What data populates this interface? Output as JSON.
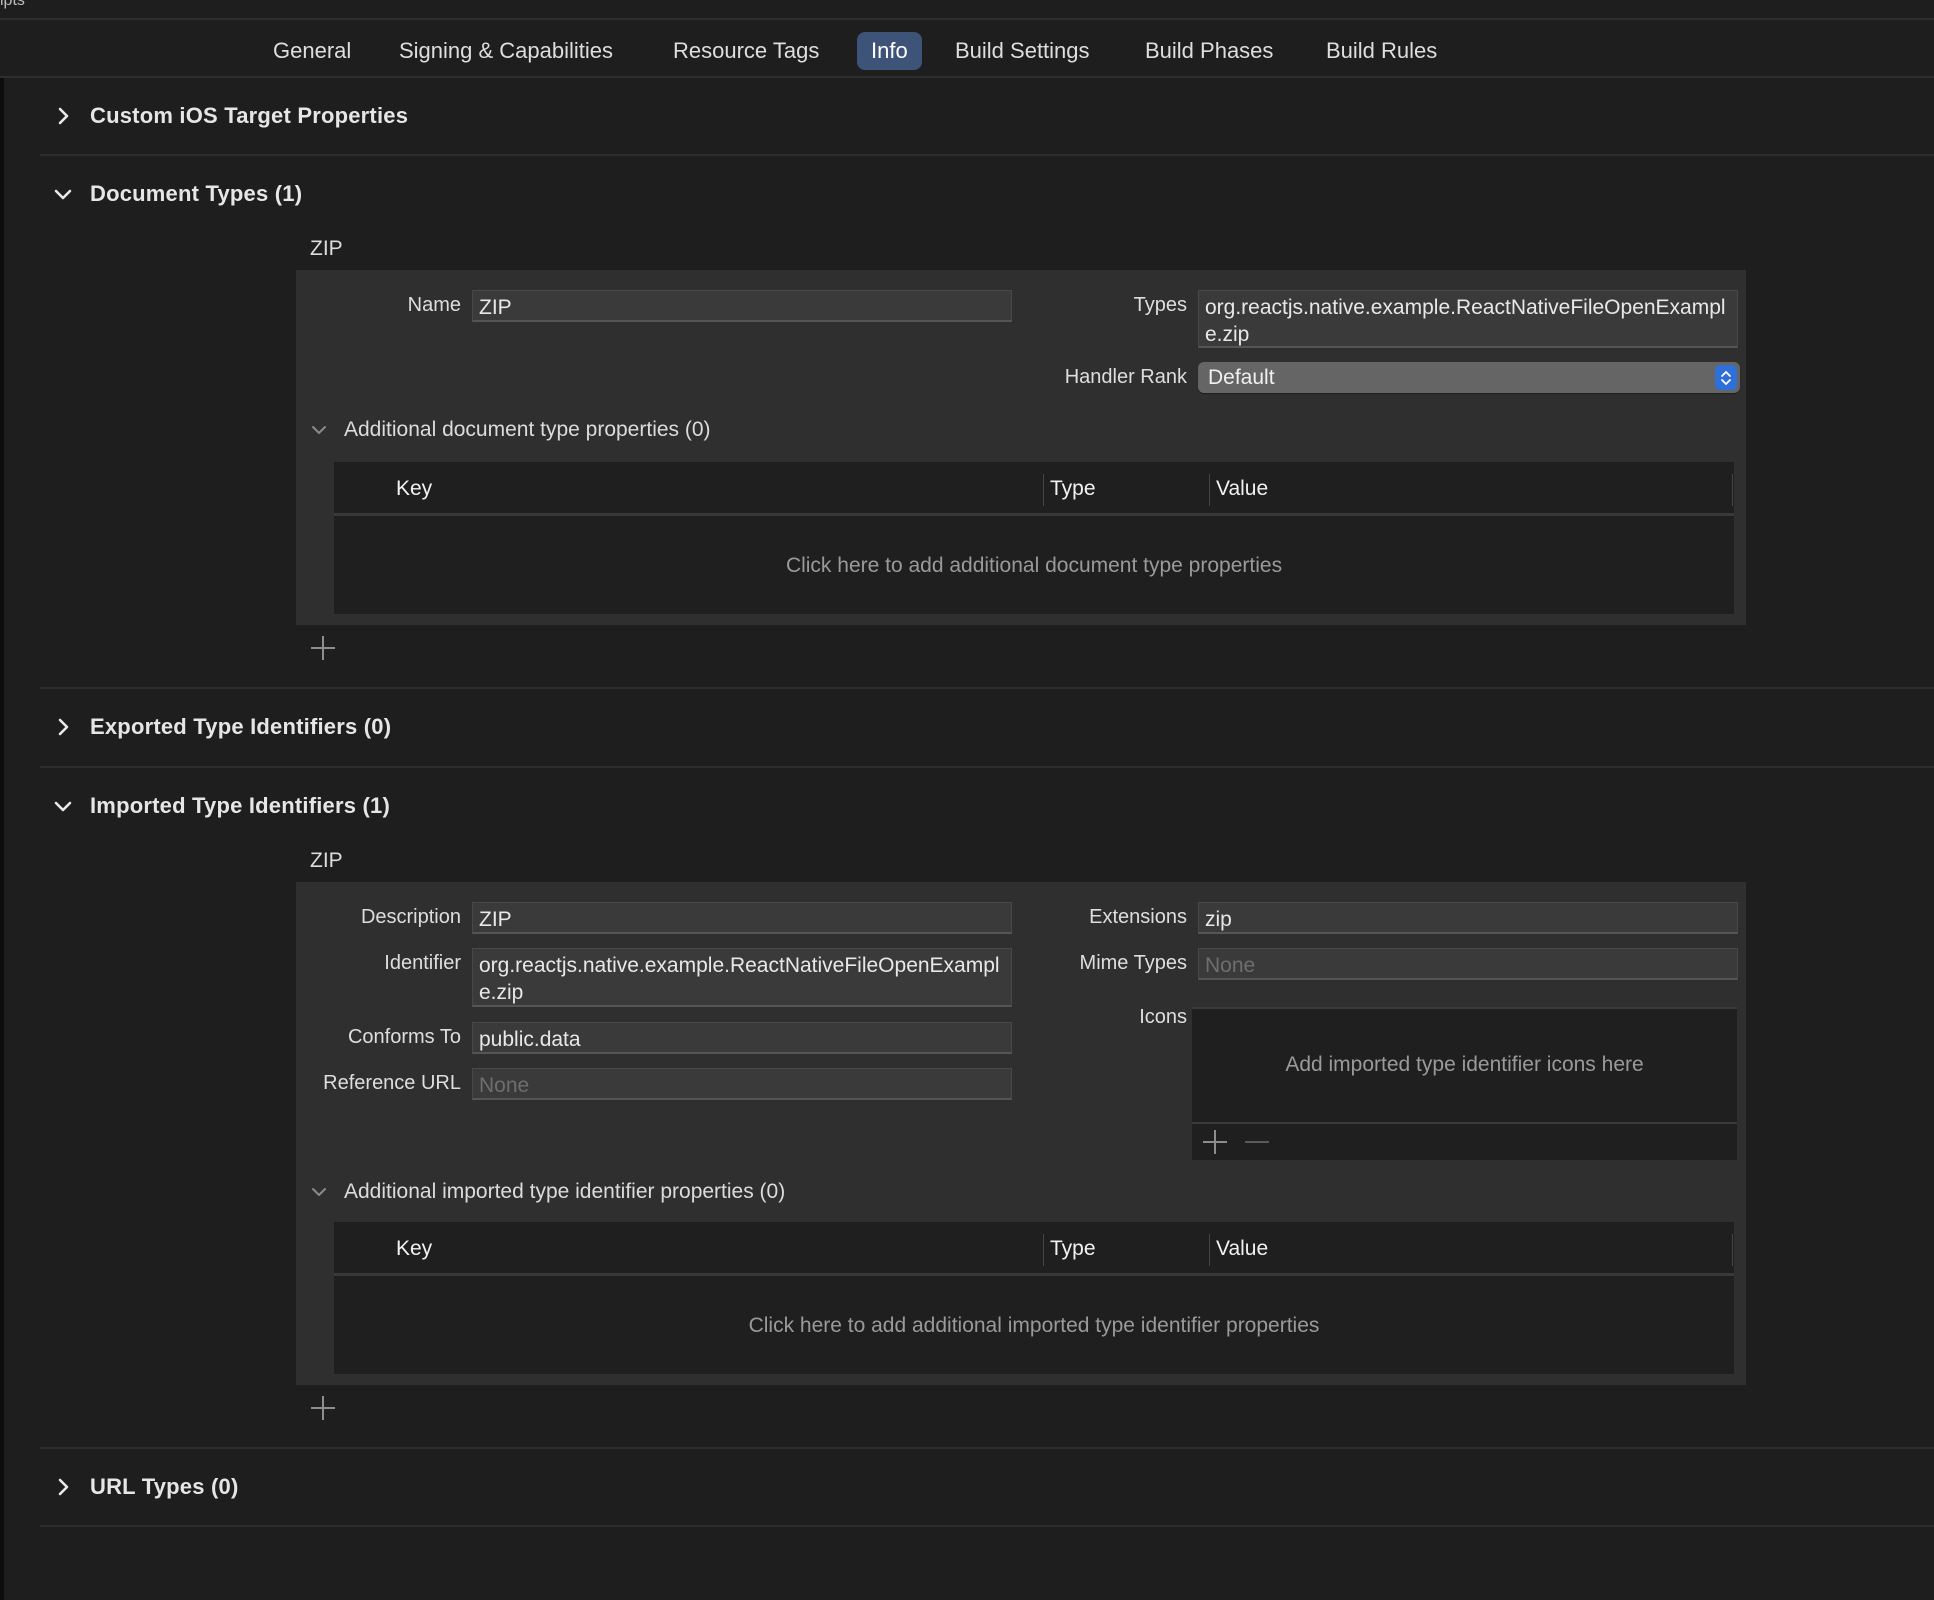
{
  "top_strip": {
    "text": "ipts"
  },
  "tabs": [
    {
      "label": "General",
      "active": false
    },
    {
      "label": "Signing & Capabilities",
      "active": false
    },
    {
      "label": "Resource Tags",
      "active": false
    },
    {
      "label": "Info",
      "active": true
    },
    {
      "label": "Build Settings",
      "active": false
    },
    {
      "label": "Build Phases",
      "active": false
    },
    {
      "label": "Build Rules",
      "active": false
    }
  ],
  "colors": {
    "accent_tab": "#3d5377",
    "stepper_blue": "#2f6fd9",
    "background": "#1e1e1e",
    "panel": "#2f2f2f"
  },
  "sections": {
    "custom_ios": {
      "title": "Custom iOS Target Properties",
      "expanded": false,
      "icon": "chevron-right-icon"
    },
    "document_types": {
      "title": "Document Types (1)",
      "expanded": true,
      "icon": "chevron-down-icon",
      "item": {
        "heading": "ZIP",
        "name_label": "Name",
        "name_value": "ZIP",
        "types_label": "Types",
        "types_value": "org.reactjs.native.example.ReactNativeFileOpenExample.zip",
        "handler_rank_label": "Handler Rank",
        "handler_rank_value": "Default",
        "additional": {
          "title": "Additional document type properties (0)",
          "columns": [
            "Key",
            "Type",
            "Value"
          ],
          "empty_text": "Click here to add additional document type properties"
        }
      },
      "add_icon": "plus-icon"
    },
    "exported": {
      "title": "Exported Type Identifiers (0)",
      "expanded": false,
      "icon": "chevron-right-icon"
    },
    "imported": {
      "title": "Imported Type Identifiers (1)",
      "expanded": true,
      "icon": "chevron-down-icon",
      "item": {
        "heading": "ZIP",
        "description_label": "Description",
        "description_value": "ZIP",
        "identifier_label": "Identifier",
        "identifier_value": "org.reactjs.native.example.ReactNativeFileOpenExample.zip",
        "conforms_label": "Conforms To",
        "conforms_value": "public.data",
        "reference_url_label": "Reference URL",
        "reference_url_placeholder": "None",
        "extensions_label": "Extensions",
        "extensions_value": "zip",
        "mime_label": "Mime Types",
        "mime_placeholder": "None",
        "icons_label": "Icons",
        "icons_empty_text": "Add imported type identifier icons here",
        "additional": {
          "title": "Additional imported type identifier properties (0)",
          "columns": [
            "Key",
            "Type",
            "Value"
          ],
          "empty_text": "Click here to add additional imported type identifier properties"
        }
      },
      "add_icon": "plus-icon"
    },
    "url_types": {
      "title": "URL Types (0)",
      "expanded": false,
      "icon": "chevron-right-icon"
    }
  }
}
